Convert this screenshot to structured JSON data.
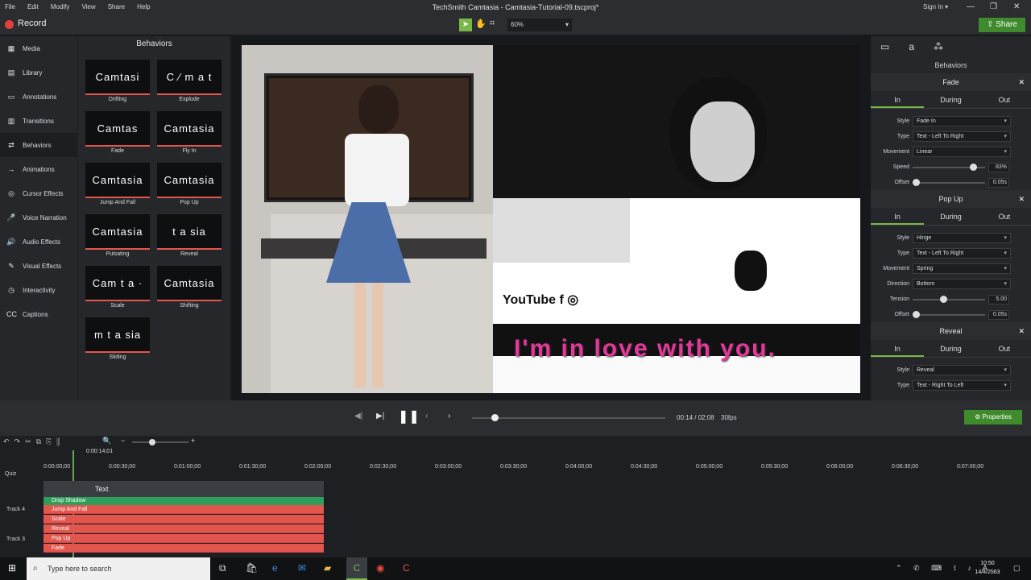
{
  "window_title": "TechSmith Camtasia - Camtasia-Tutorial-09.tscproj*",
  "menu": [
    "File",
    "Edit",
    "Modify",
    "View",
    "Share",
    "Help"
  ],
  "sign_in": "Sign In ▾",
  "record_label": "Record",
  "zoom_level": "60%",
  "share_label": "Share",
  "sidebar": {
    "items": [
      {
        "label": "Media",
        "icon": "film-icon"
      },
      {
        "label": "Library",
        "icon": "library-icon"
      },
      {
        "label": "Annotations",
        "icon": "annotation-icon"
      },
      {
        "label": "Transitions",
        "icon": "transition-icon"
      },
      {
        "label": "Behaviors",
        "icon": "behaviors-icon"
      },
      {
        "label": "Animations",
        "icon": "animation-icon"
      },
      {
        "label": "Cursor Effects",
        "icon": "cursor-icon"
      },
      {
        "label": "Voice Narration",
        "icon": "microphone-icon"
      },
      {
        "label": "Audio Effects",
        "icon": "speaker-icon"
      },
      {
        "label": "Visual Effects",
        "icon": "wand-icon"
      },
      {
        "label": "Interactivity",
        "icon": "interactivity-icon"
      },
      {
        "label": "Captions",
        "icon": "cc-icon"
      }
    ]
  },
  "library": {
    "title": "Behaviors",
    "tiles": [
      {
        "preview": "Camtasi",
        "label": "Drifting"
      },
      {
        "preview": "C ⁄ m a t",
        "label": "Explode"
      },
      {
        "preview": "Camtas",
        "label": "Fade"
      },
      {
        "preview": "Camtasia",
        "label": "Fly In"
      },
      {
        "preview": "Camtasia",
        "label": "Jump And Fall"
      },
      {
        "preview": "Camtasia",
        "label": "Pop Up"
      },
      {
        "preview": "Camtasia",
        "label": "Pulsating"
      },
      {
        "preview": "t a sia",
        "label": "Reveal"
      },
      {
        "preview": "Cam t a ·",
        "label": "Scale"
      },
      {
        "preview": "Camtasia",
        "label": "Shifting"
      },
      {
        "preview": "m t a sia",
        "label": "Sliding"
      }
    ]
  },
  "canvas": {
    "caption": "I'm in love with you.",
    "social": "YouTube  f  ◎"
  },
  "props": {
    "title": "Behaviors",
    "sections": [
      {
        "name": "Fade",
        "tabs": [
          "In",
          "During",
          "Out"
        ],
        "rows": [
          {
            "label": "Style",
            "value": "Fade In",
            "kind": "select"
          },
          {
            "label": "Type",
            "value": "Text - Left To Right",
            "kind": "select"
          },
          {
            "label": "Movement",
            "value": "Linear",
            "kind": "select"
          },
          {
            "label": "Speed",
            "value": "83%",
            "kind": "slider",
            "level": 0.83
          },
          {
            "label": "Offset",
            "value": "0.05s",
            "kind": "slider",
            "level": 0.0
          }
        ]
      },
      {
        "name": "Pop Up",
        "tabs": [
          "In",
          "During",
          "Out"
        ],
        "rows": [
          {
            "label": "Style",
            "value": "Hinge",
            "kind": "select"
          },
          {
            "label": "Type",
            "value": "Text - Left To Right",
            "kind": "select"
          },
          {
            "label": "Movement",
            "value": "Spring",
            "kind": "select"
          },
          {
            "label": "Direction",
            "value": "Bottom",
            "kind": "select"
          },
          {
            "label": "Tension",
            "value": "5.00",
            "kind": "slider",
            "level": 0.4
          },
          {
            "label": "Offset",
            "value": "0.05s",
            "kind": "slider",
            "level": 0.0
          }
        ]
      },
      {
        "name": "Reveal",
        "tabs": [
          "In",
          "During",
          "Out"
        ],
        "rows": [
          {
            "label": "Style",
            "value": "Reveal",
            "kind": "select"
          },
          {
            "label": "Type",
            "value": "Text - Right To Left",
            "kind": "select"
          }
        ]
      }
    ]
  },
  "player": {
    "time": "00:14 / 02:08",
    "fps": "30fps",
    "properties_label": "Properties"
  },
  "timeline": {
    "playhead": "0:00:14;01",
    "ticks": [
      "0:00:00;00",
      "0:00:30;00",
      "0:01:00;00",
      "0:01:30;00",
      "0:02:00;00",
      "0:02:30;00",
      "0:03:00;00",
      "0:03:30;00",
      "0:04:00;00",
      "0:04:30;00",
      "0:05:00;00",
      "0:05:30;00",
      "0:06:00;00",
      "0:06:30;00",
      "0:07:00;00"
    ],
    "quiz_label": "Quiz",
    "text_clip": "Text",
    "drop_shadow": "Drop Shadow",
    "effects": [
      "Jump And Fall",
      "Scale",
      "Reveal",
      "Pop Up",
      "Fade"
    ],
    "tracks": [
      "Track 4",
      "Track 3"
    ]
  },
  "taskbar": {
    "search_placeholder": "Type here to search",
    "time": "10:50",
    "date": "14/4/2563"
  }
}
